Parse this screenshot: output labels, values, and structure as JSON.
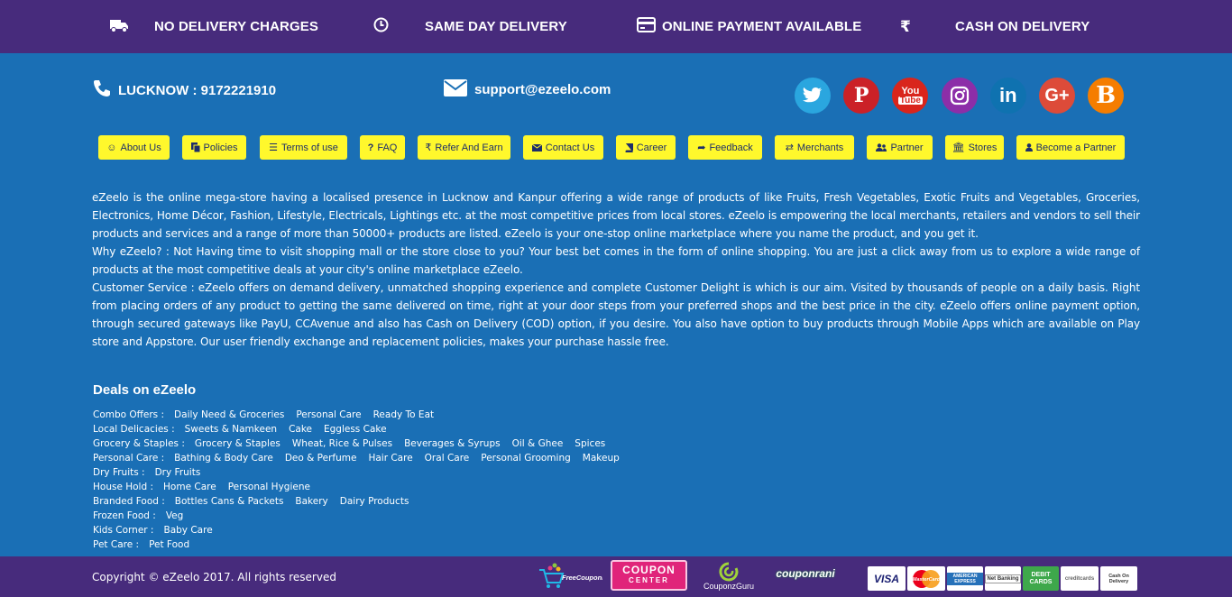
{
  "features": [
    {
      "label": "NO DELIVERY CHARGES",
      "icon": "truck-icon"
    },
    {
      "label": "SAME DAY DELIVERY",
      "icon": "clock-icon"
    },
    {
      "label": "ONLINE PAYMENT AVAILABLE",
      "icon": "credit-card-icon"
    },
    {
      "label": "CASH ON DELIVERY",
      "icon": "rupee-icon"
    }
  ],
  "contact": {
    "phone": "LUCKNOW : 9172221910",
    "email": "support@ezeelo.com"
  },
  "social": [
    {
      "name": "twitter",
      "glyph": "",
      "color": "#2aa6df"
    },
    {
      "name": "pinterest",
      "glyph": "P",
      "color": "#cb2127"
    },
    {
      "name": "youtube",
      "glyph": "You Tube",
      "color": "#d9251c"
    },
    {
      "name": "instagram",
      "glyph": "",
      "color": "#8c2ea8"
    },
    {
      "name": "linkedin",
      "glyph": "in",
      "color": "#0f72b0"
    },
    {
      "name": "google-plus",
      "glyph": "G+",
      "color": "#dd4b39"
    },
    {
      "name": "blogger",
      "glyph": "B",
      "color": "#f57d00"
    }
  ],
  "nav": [
    {
      "label": "About Us",
      "icon": "smile-icon"
    },
    {
      "label": "Policies",
      "icon": "copy-icon"
    },
    {
      "label": "Terms of use",
      "icon": "list-icon"
    },
    {
      "label": "FAQ",
      "icon": "question-icon"
    },
    {
      "label": "Refer And Earn",
      "icon": "rupee-icon"
    },
    {
      "label": "Contact Us",
      "icon": "envelope-icon"
    },
    {
      "label": "Career",
      "icon": "book-icon"
    },
    {
      "label": "Feedback",
      "icon": "share-icon"
    },
    {
      "label": "Merchants",
      "icon": "exchange-icon"
    },
    {
      "label": "Partner",
      "icon": "users-icon"
    },
    {
      "label": "Stores",
      "icon": "bank-icon"
    },
    {
      "label": "Become a Partner",
      "icon": "user-icon"
    }
  ],
  "description": [
    "eZeelo is the online mega-store having a localised presence in Lucknow and Kanpur offering a wide range of products of like Fruits, Fresh Vegetables, Exotic Fruits and Vegetables, Groceries, Electronics, Home Décor, Fashion, Lifestyle, Electricals, Lightings etc. at the most competitive prices from local stores. eZeelo is empowering the local merchants, retailers and vendors to sell their products and services and a range of more than 50000+ products are listed. eZeelo is your one-stop online marketplace where you name the product, and you get it.",
    "Why eZeelo? : Not Having time to visit shopping mall or the store close to you? Your best bet comes in the form of online shopping. You are just a click away from us to explore a wide range of products at the most competitive deals at your city's online marketplace eZeelo.",
    "Customer Service : eZeelo offers on demand delivery, unmatched shopping experience and complete Customer Delight is which is our aim. Visited by thousands of people on a daily basis. Right from placing orders of any product to getting the same delivered on time, right at your door steps from your preferred shops and the best price in the city. eZeelo offers online payment option, through secured gateways like PayU, CCAvenue and also has Cash on Delivery (COD) option, if you desire. You also have option to buy products through Mobile Apps which are available on Play store and Appstore. Our user friendly exchange and replacement policies, makes your purchase hassle free."
  ],
  "deals": {
    "title": "Deals on eZeelo",
    "rows": [
      {
        "category": "Combo Offers :",
        "links": [
          "Daily Need & Groceries",
          "Personal Care",
          "Ready To Eat"
        ]
      },
      {
        "category": "Local Delicacies :",
        "links": [
          "Sweets & Namkeen",
          "Cake",
          "Eggless Cake"
        ]
      },
      {
        "category": "Grocery & Staples :",
        "links": [
          "Grocery & Staples",
          "Wheat, Rice & Pulses",
          "Beverages & Syrups",
          "Oil & Ghee",
          "Spices"
        ]
      },
      {
        "category": "Personal Care :",
        "links": [
          "Bathing & Body Care",
          "Deo & Perfume",
          "Hair Care",
          "Oral Care",
          "Personal Grooming",
          "Makeup"
        ]
      },
      {
        "category": "Dry Fruits :",
        "links": [
          "Dry Fruits"
        ]
      },
      {
        "category": "House Hold :",
        "links": [
          "Home Care",
          "Personal Hygiene"
        ]
      },
      {
        "category": "Branded Food :",
        "links": [
          "Bottles Cans & Packets",
          "Bakery",
          "Dairy Products"
        ]
      },
      {
        "category": "Frozen Food :",
        "links": [
          "Veg"
        ]
      },
      {
        "category": "Kids Corner :",
        "links": [
          "Baby Care"
        ]
      },
      {
        "category": "Pet Care :",
        "links": [
          "Pet Food"
        ]
      }
    ]
  },
  "footer": {
    "copyright": "Copyright © eZeelo 2017. All rights reserved",
    "coupon_sites": [
      {
        "name": "FreeCouponIndia",
        "label": "FreeCouponIndia"
      },
      {
        "name": "CouponCenter",
        "label": "COUPON",
        "sub": "CENTER"
      },
      {
        "name": "CouponzGuru",
        "label": "CouponzGuru"
      },
      {
        "name": "CouponRani",
        "label": "couponrani"
      }
    ],
    "payment_methods": [
      {
        "name": "visa",
        "label": "VISA"
      },
      {
        "name": "mastercard",
        "label": "MasterCard"
      },
      {
        "name": "american-express",
        "label": "AMERICAN EXPRESS"
      },
      {
        "name": "net-banking",
        "label": "Net Banking"
      },
      {
        "name": "debit-cards",
        "label": "DEBIT CARDS"
      },
      {
        "name": "credit-cards",
        "label": "creditcards"
      },
      {
        "name": "cash-on-delivery",
        "label": "Cash On Delivery"
      }
    ]
  }
}
